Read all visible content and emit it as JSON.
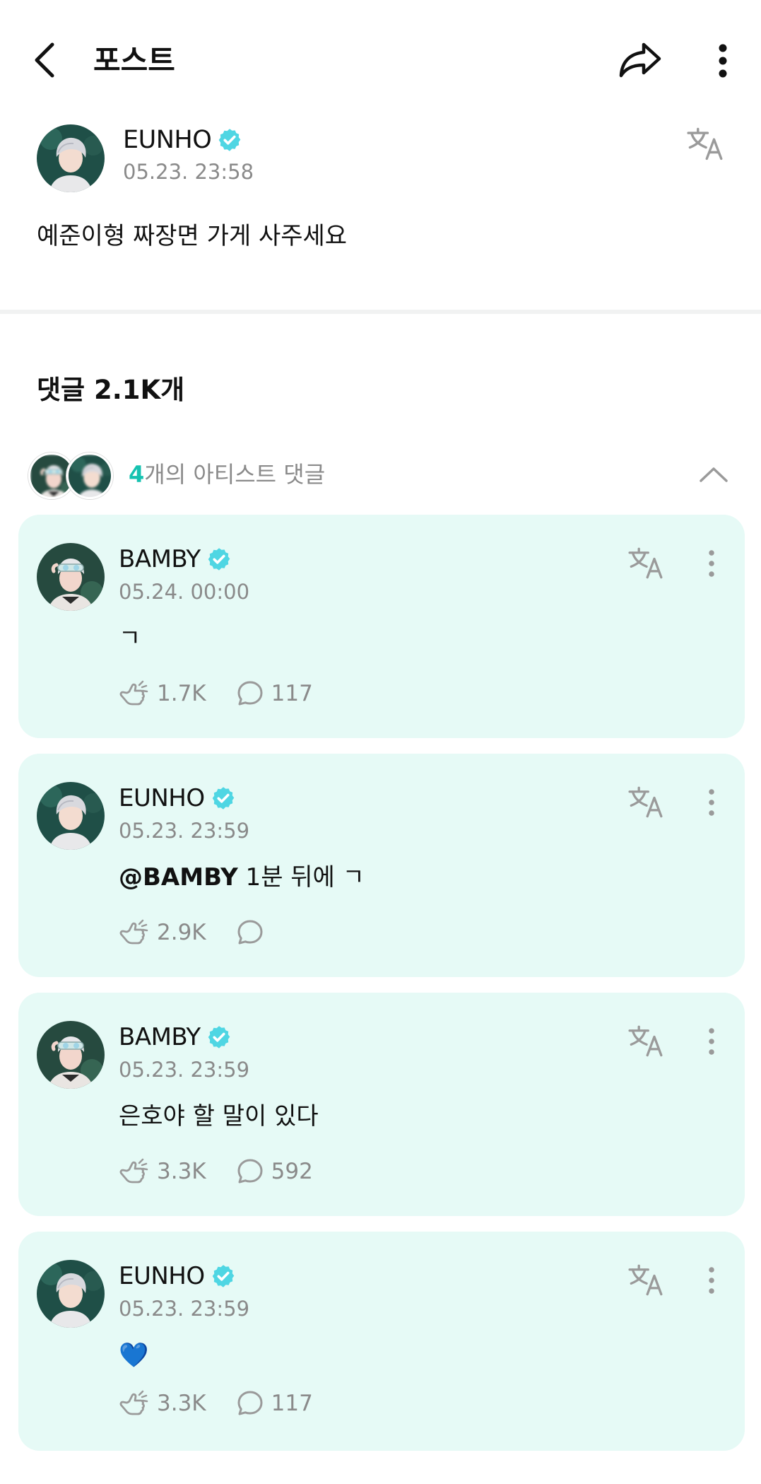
{
  "header": {
    "title": "포스트"
  },
  "post": {
    "author": "EUNHO",
    "time": "05.23. 23:58",
    "body": "예준이형 짜장면 가게 사주세요"
  },
  "comments": {
    "heading": "댓글 2.1K개",
    "artist_count": "4",
    "artist_label": "개의 아티스트 댓글"
  },
  "cards": [
    {
      "author": "BAMBY",
      "time": "05.24. 00:00",
      "mention": "",
      "text": "ㄱ",
      "likes": "1.7K",
      "replies": "117"
    },
    {
      "author": "EUNHO",
      "time": "05.23. 23:59",
      "mention": "@BAMBY",
      "text": " 1분 뒤에 ㄱ",
      "likes": "2.9K",
      "replies": ""
    },
    {
      "author": "BAMBY",
      "time": "05.23. 23:59",
      "mention": "",
      "text": "은호야 할 말이 있다",
      "likes": "3.3K",
      "replies": "592"
    },
    {
      "author": "EUNHO",
      "time": "05.23. 23:59",
      "mention": "",
      "text": "💙",
      "likes": "3.3K",
      "replies": "117"
    }
  ],
  "icons": {
    "back": "arrow-left-icon",
    "share": "share-icon",
    "more": "more-vertical-icon",
    "translate": "translate-icon",
    "verified": "verified-badge-icon",
    "like": "like-icon",
    "reply": "reply-icon",
    "collapse": "chevron-up-icon"
  },
  "colors": {
    "accent": "#16c2b0",
    "verified": "#4fd6e3",
    "card_bg": "#e6faf6",
    "muted": "#8a8a8a"
  }
}
